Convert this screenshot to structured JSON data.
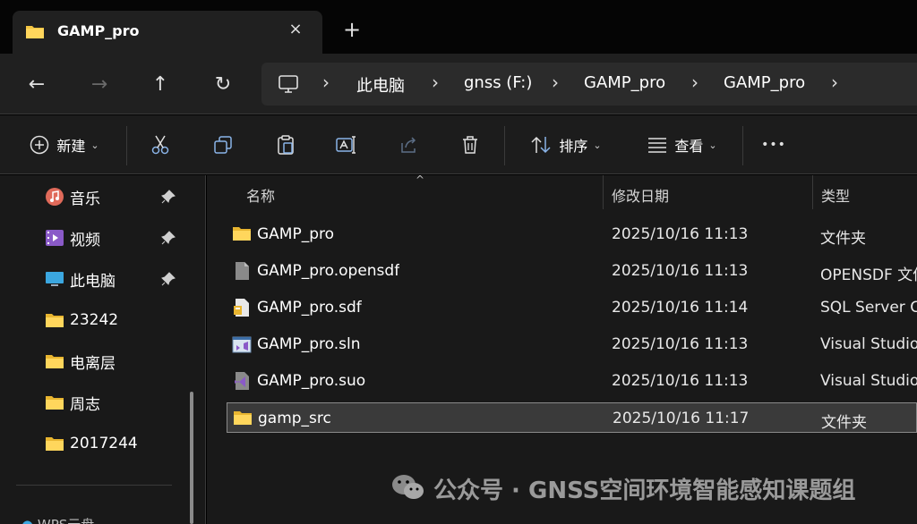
{
  "tab": {
    "title": "GAMP_pro",
    "close_icon": "×",
    "new_tab_icon": "+"
  },
  "nav": {
    "back_icon": "←",
    "forward_icon": "→",
    "up_icon": "↑",
    "refresh_icon": "↻",
    "breadcrumbs": [
      "此电脑",
      "gnss (F:)",
      "GAMP_pro",
      "GAMP_pro"
    ],
    "chevron": "›"
  },
  "toolbar": {
    "new_label": "新建",
    "sort_label": "排序",
    "view_label": "查看",
    "more_icon": "•••",
    "dropdown_icon": "⌄"
  },
  "sidebar": {
    "items": [
      {
        "label": "音乐",
        "icon": "music-icon",
        "pinned": true
      },
      {
        "label": "视频",
        "icon": "video-icon",
        "pinned": true
      },
      {
        "label": "此电脑",
        "icon": "computer-icon",
        "pinned": true
      },
      {
        "label": "23242",
        "icon": "folder-icon",
        "pinned": false
      },
      {
        "label": "电离层",
        "icon": "folder-icon",
        "pinned": false
      },
      {
        "label": "周志",
        "icon": "folder-icon",
        "pinned": false
      },
      {
        "label": "2017244",
        "icon": "folder-icon",
        "pinned": false
      }
    ],
    "partial_item": "WPS云盘"
  },
  "columns": {
    "name": "名称",
    "modified": "修改日期",
    "type": "类型",
    "sort_arrow": "^"
  },
  "files": [
    {
      "name": "GAMP_pro",
      "date": "2025/10/16 11:13",
      "type": "文件夹",
      "icon": "folder-icon",
      "selected": false
    },
    {
      "name": "GAMP_pro.opensdf",
      "date": "2025/10/16 11:13",
      "type": "OPENSDF 文件",
      "icon": "file-icon",
      "selected": false
    },
    {
      "name": "GAMP_pro.sdf",
      "date": "2025/10/16 11:14",
      "type": "SQL Server Compact",
      "icon": "sdf-file-icon",
      "selected": false
    },
    {
      "name": "GAMP_pro.sln",
      "date": "2025/10/16 11:13",
      "type": "Visual Studio Solution",
      "icon": "sln-file-icon",
      "selected": false
    },
    {
      "name": "GAMP_pro.suo",
      "date": "2025/10/16 11:13",
      "type": "Visual Studio Options",
      "icon": "suo-file-icon",
      "selected": false
    },
    {
      "name": "gamp_src",
      "date": "2025/10/16 11:17",
      "type": "文件夹",
      "icon": "folder-icon",
      "selected": true
    }
  ],
  "watermark": {
    "text": "公众号 · GNSS空间环境智能感知课题组",
    "icon": "wechat-icon"
  },
  "colors": {
    "folder": "#F4C542",
    "selection_bg": "#3a3a3a",
    "background": "#191919"
  }
}
